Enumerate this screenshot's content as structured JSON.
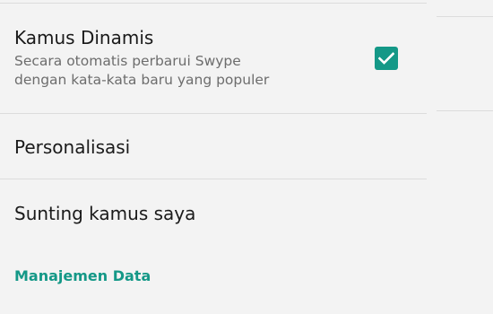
{
  "settings": {
    "dynamic_dictionary": {
      "title": "Kamus Dinamis",
      "summary_line1": "Secara otomatis perbarui Swype",
      "summary_line2": "dengan kata-kata baru yang populer",
      "checked": true
    },
    "personalization": {
      "title": "Personalisasi"
    },
    "edit_dictionary": {
      "title": "Sunting kamus saya"
    },
    "data_management": {
      "title": "Manajemen Data"
    }
  },
  "colors": {
    "accent": "#149887",
    "background": "#f3f3f3",
    "divider": "#dcdcdc"
  }
}
